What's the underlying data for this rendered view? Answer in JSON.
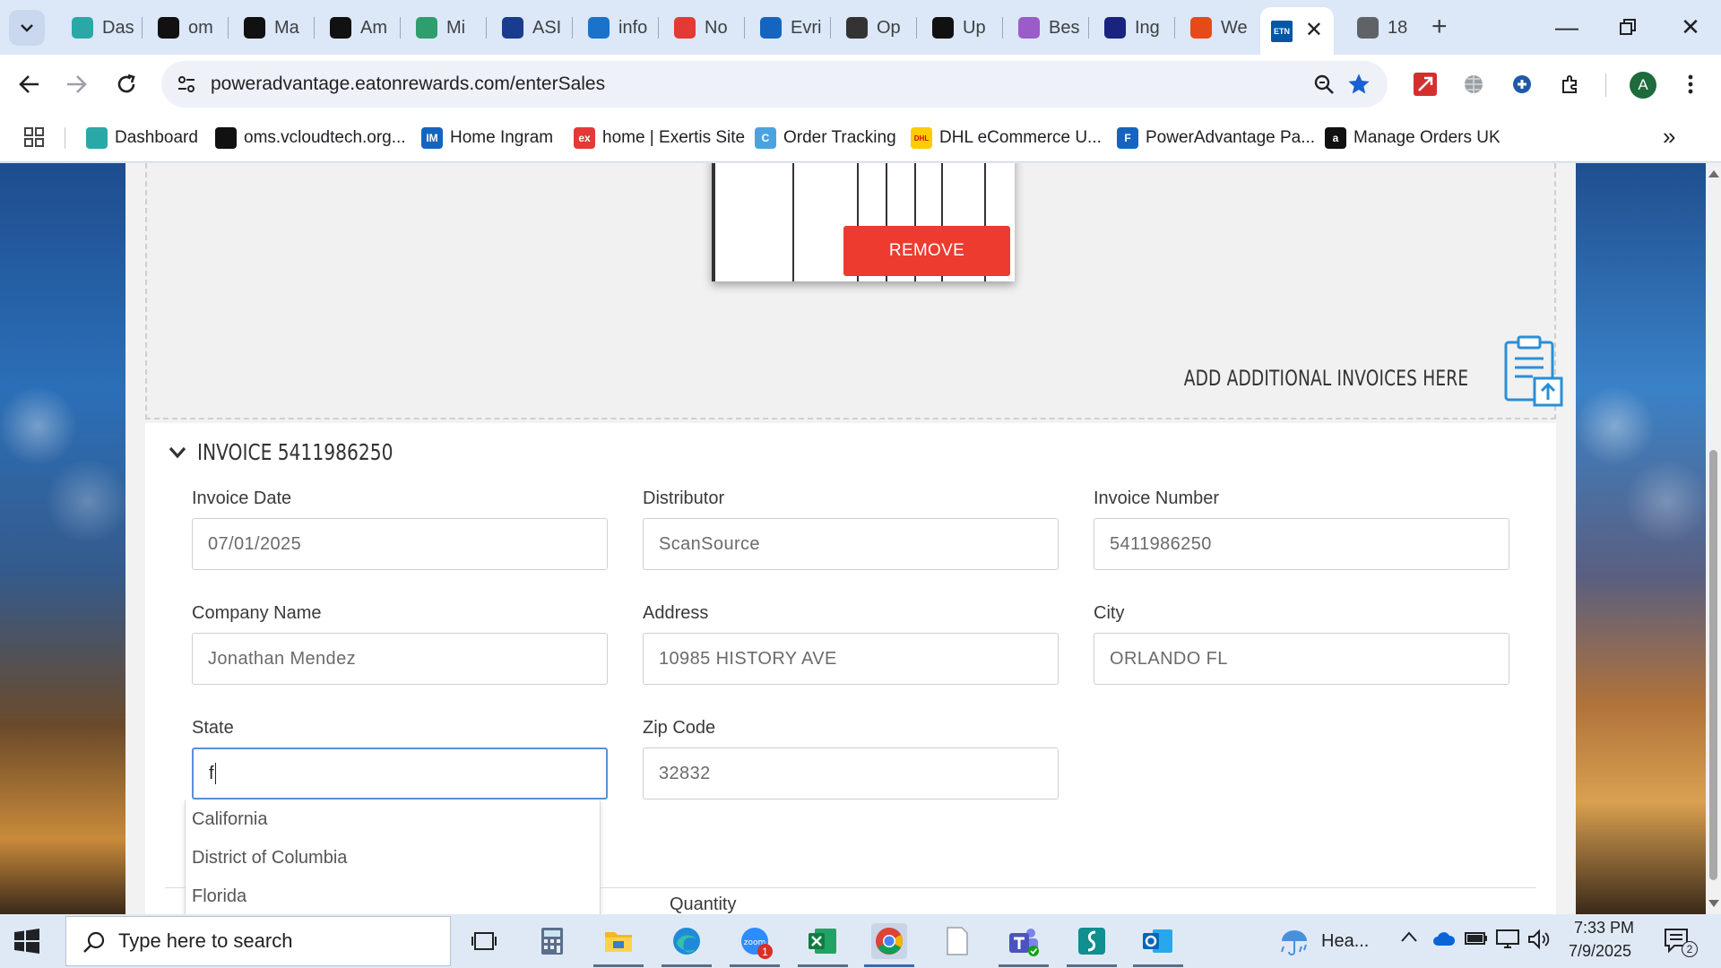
{
  "browser": {
    "tabs": [
      {
        "label": "Das",
        "icon": "dashboard-icon",
        "color": "#2aa8a8"
      },
      {
        "label": "om",
        "icon": "oms-icon",
        "color": "#111111"
      },
      {
        "label": "Ma",
        "icon": "amazon-icon",
        "color": "#111111"
      },
      {
        "label": "Am",
        "icon": "amazon-icon",
        "color": "#111111"
      },
      {
        "label": "Mi",
        "icon": "mi-icon",
        "color": "#2e9e6f"
      },
      {
        "label": "ASI",
        "icon": "asi-icon",
        "color": "#1a3c8f"
      },
      {
        "label": "info",
        "icon": "info-icon",
        "color": "#1a73c8"
      },
      {
        "label": "No",
        "icon": "exertis-icon",
        "color": "#e53935"
      },
      {
        "label": "Evri",
        "icon": "evri-icon",
        "color": "#1565c0"
      },
      {
        "label": "Op",
        "icon": "openai-icon",
        "color": "#333333"
      },
      {
        "label": "Up",
        "icon": "openai-icon",
        "color": "#111111"
      },
      {
        "label": "Bes",
        "icon": "bulb-icon",
        "color": "#9a5cc9"
      },
      {
        "label": "Ing",
        "icon": "bu-icon",
        "color": "#1a237e"
      },
      {
        "label": "We",
        "icon": "web-icon",
        "color": "#e64a19"
      },
      {
        "label": "",
        "icon": "etn-icon",
        "color": "#0057a8",
        "active": true
      },
      {
        "label": "18",
        "icon": "globe-icon",
        "color": "#5f6368"
      }
    ],
    "url": "poweradvantage.eatonrewards.com/enterSales",
    "bookmarks": [
      {
        "label": "Dashboard",
        "icon": "dashboard-icon",
        "color": "#2aa8a8"
      },
      {
        "label": "oms.vcloudtech.org...",
        "icon": "oms-icon",
        "color": "#111111"
      },
      {
        "label": "Home Ingram",
        "icon": "im-icon",
        "color": "#1565c0",
        "glyph": "IM"
      },
      {
        "label": "home | Exertis Site",
        "icon": "exertis-icon",
        "color": "#e53935",
        "glyph": "ex"
      },
      {
        "label": "Order Tracking",
        "icon": "order-tracking-icon",
        "color": "#4aa3df",
        "glyph": "C"
      },
      {
        "label": "DHL eCommerce U...",
        "icon": "dhl-icon",
        "color": "#ffcc00",
        "glyph": "DHL"
      },
      {
        "label": "PowerAdvantage Pa...",
        "icon": "poweradvantage-icon",
        "color": "#1565c0",
        "glyph": "F"
      },
      {
        "label": "Manage Orders UK",
        "icon": "amazon-icon",
        "color": "#111111",
        "glyph": "a"
      }
    ]
  },
  "upload": {
    "remove_label": "REMOVE",
    "add_invoices_label": "ADD ADDITIONAL INVOICES HERE"
  },
  "invoice": {
    "title": "INVOICE 5411986250",
    "fields": {
      "invoice_date": {
        "label": "Invoice Date",
        "value": "07/01/2025"
      },
      "distributor": {
        "label": "Distributor",
        "value": "ScanSource"
      },
      "invoice_number": {
        "label": "Invoice Number",
        "value": "5411986250"
      },
      "company_name": {
        "label": "Company Name",
        "value": "Jonathan Mendez"
      },
      "address": {
        "label": "Address",
        "value": "10985 HISTORY AVE"
      },
      "city": {
        "label": "City",
        "value": "ORLANDO FL"
      },
      "state": {
        "label": "State",
        "value": "f"
      },
      "zip": {
        "label": "Zip Code",
        "value": "32832"
      }
    },
    "state_suggestions": [
      "California",
      "District of Columbia",
      "Florida"
    ],
    "quantity_label": "Quantity"
  },
  "taskbar": {
    "search_placeholder": "Type here to search",
    "weather_label": "Hea...",
    "time": "7:33 PM",
    "date": "7/9/2025",
    "notification_count": "2",
    "zoom_badge": "1"
  }
}
